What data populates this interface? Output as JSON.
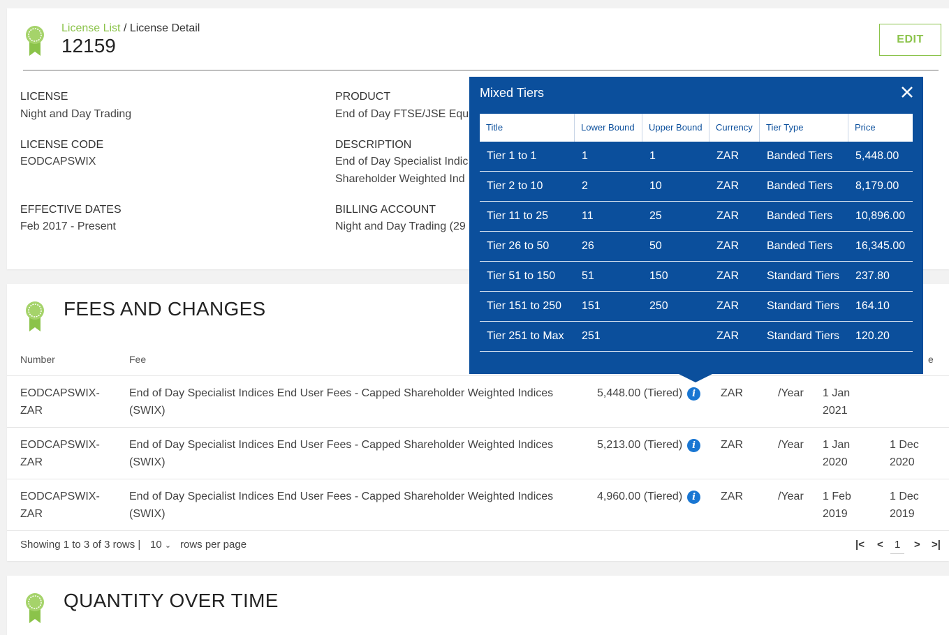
{
  "header": {
    "breadcrumb_link": "License List",
    "breadcrumb_sep": " / ",
    "breadcrumb_current": "License Detail",
    "title": "12159",
    "edit_label": "EDIT"
  },
  "license": {
    "license_label": "LICENSE",
    "license_value": "Night and Day Trading",
    "code_label": "LICENSE CODE",
    "code_value": "EODCAPSWIX",
    "dates_label": "EFFECTIVE DATES",
    "dates_value": "Feb 2017 - Present",
    "product_label": "PRODUCT",
    "product_value": "End of Day FTSE/JSE Equ",
    "description_label": "DESCRIPTION",
    "description_line1": "End of Day Specialist Indic",
    "description_line2": "Shareholder Weighted Ind",
    "billing_label": "BILLING ACCOUNT",
    "billing_value": "Night and Day Trading (29"
  },
  "fees": {
    "section_title": "FEES AND CHANGES",
    "col_number": "Number",
    "col_fee": "Fee",
    "col_end_partial": "e",
    "rows": [
      {
        "number_line1": "EODCAPSWIX-",
        "number_line2": "ZAR",
        "fee_line1": "End of Day Specialist Indices End User Fees - Capped Shareholder Weighted Indices",
        "fee_line2": "(SWIX)",
        "amount": "5,448.00 (Tiered)",
        "currency": "ZAR",
        "period": "/Year",
        "start_line1": "1 Jan",
        "start_line2": "2021",
        "end_line1": "",
        "end_line2": ""
      },
      {
        "number_line1": "EODCAPSWIX-",
        "number_line2": "ZAR",
        "fee_line1": "End of Day Specialist Indices End User Fees - Capped Shareholder Weighted Indices",
        "fee_line2": "(SWIX)",
        "amount": "5,213.00 (Tiered)",
        "currency": "ZAR",
        "period": "/Year",
        "start_line1": "1 Jan",
        "start_line2": "2020",
        "end_line1": "1 Dec",
        "end_line2": "2020"
      },
      {
        "number_line1": "EODCAPSWIX-",
        "number_line2": "ZAR",
        "fee_line1": "End of Day Specialist Indices End User Fees - Capped Shareholder Weighted Indices",
        "fee_line2": "(SWIX)",
        "amount": "4,960.00 (Tiered)",
        "currency": "ZAR",
        "period": "/Year",
        "start_line1": "1 Feb",
        "start_line2": "2019",
        "end_line1": "1 Dec",
        "end_line2": "2019"
      }
    ],
    "footer_showing": "Showing 1 to 3 of 3 rows |",
    "footer_rpp_value": "10",
    "footer_rpp_text": "rows per page",
    "pager": {
      "first": "|<",
      "prev": "<",
      "page": "1",
      "next": ">",
      "last": ">|"
    }
  },
  "quantity": {
    "section_title": "QUANTITY OVER TIME"
  },
  "popup": {
    "title": "Mixed Tiers",
    "close": "×",
    "columns": [
      "Title",
      "Lower Bound",
      "Upper Bound",
      "Currency",
      "Tier Type",
      "Price"
    ],
    "rows": [
      [
        "Tier 1 to 1",
        "1",
        "1",
        "ZAR",
        "Banded Tiers",
        "5,448.00"
      ],
      [
        "Tier 2 to 10",
        "2",
        "10",
        "ZAR",
        "Banded Tiers",
        "8,179.00"
      ],
      [
        "Tier 11 to 25",
        "11",
        "25",
        "ZAR",
        "Banded Tiers",
        "10,896.00"
      ],
      [
        "Tier 26 to 50",
        "26",
        "50",
        "ZAR",
        "Banded Tiers",
        "16,345.00"
      ],
      [
        "Tier 51 to 150",
        "51",
        "150",
        "ZAR",
        "Standard Tiers",
        "237.80"
      ],
      [
        "Tier 151 to 250",
        "151",
        "250",
        "ZAR",
        "Standard Tiers",
        "164.10"
      ],
      [
        "Tier 251 to Max",
        "251",
        "",
        "ZAR",
        "Standard Tiers",
        "120.20"
      ]
    ]
  },
  "colors": {
    "accent_green": "#8bc34a",
    "popup_blue": "#0b4f9c",
    "info_blue": "#1976d2"
  },
  "icons": [
    "award-ribbon-icon",
    "info-icon",
    "close-icon",
    "chevron-down-icon"
  ]
}
